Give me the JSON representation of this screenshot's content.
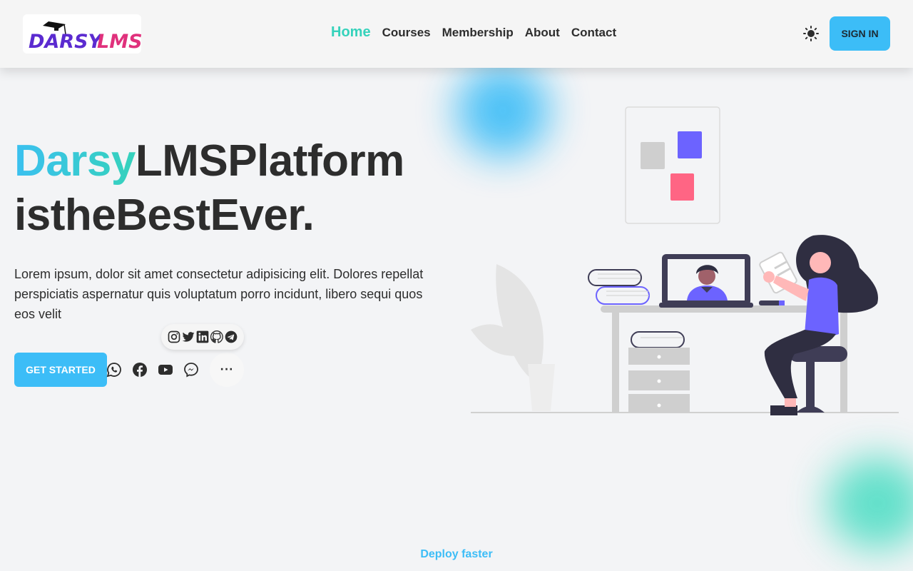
{
  "header": {
    "logo_text": "DARSY LMS",
    "nav": [
      {
        "label": "Home",
        "active": true
      },
      {
        "label": "Courses",
        "active": false
      },
      {
        "label": "Membership",
        "active": false
      },
      {
        "label": "About",
        "active": false
      },
      {
        "label": "Contact",
        "active": false
      }
    ],
    "theme_icon": "sun-icon",
    "signin_label": "SIGN IN"
  },
  "hero": {
    "title_brand": "Darsy",
    "title_rest": "LMSPlatform",
    "title_line2": "istheBestEver.",
    "description": "Lorem ipsum, dolor sit amet consectetur adipisicing elit. Dolores repellat perspiciatis aspernatur quis voluptatum porro incidunt, libero sequi quos eos velit",
    "cta_label": "GET STARTED",
    "more_label": "···",
    "share_popup_icons": [
      "instagram-icon",
      "twitter-icon",
      "linkedin-icon",
      "github-icon",
      "telegram-icon"
    ],
    "share_icons": [
      "whatsapp-icon",
      "facebook-icon",
      "youtube-icon",
      "messenger-icon"
    ]
  },
  "footer_hint": "Deploy faster",
  "colors": {
    "accent_blue": "#3cbdf7",
    "accent_teal": "#35d2bb",
    "text_dark": "#2d2d2d",
    "illustration_purple": "#6c63ff",
    "illustration_pink": "#ff6584"
  }
}
